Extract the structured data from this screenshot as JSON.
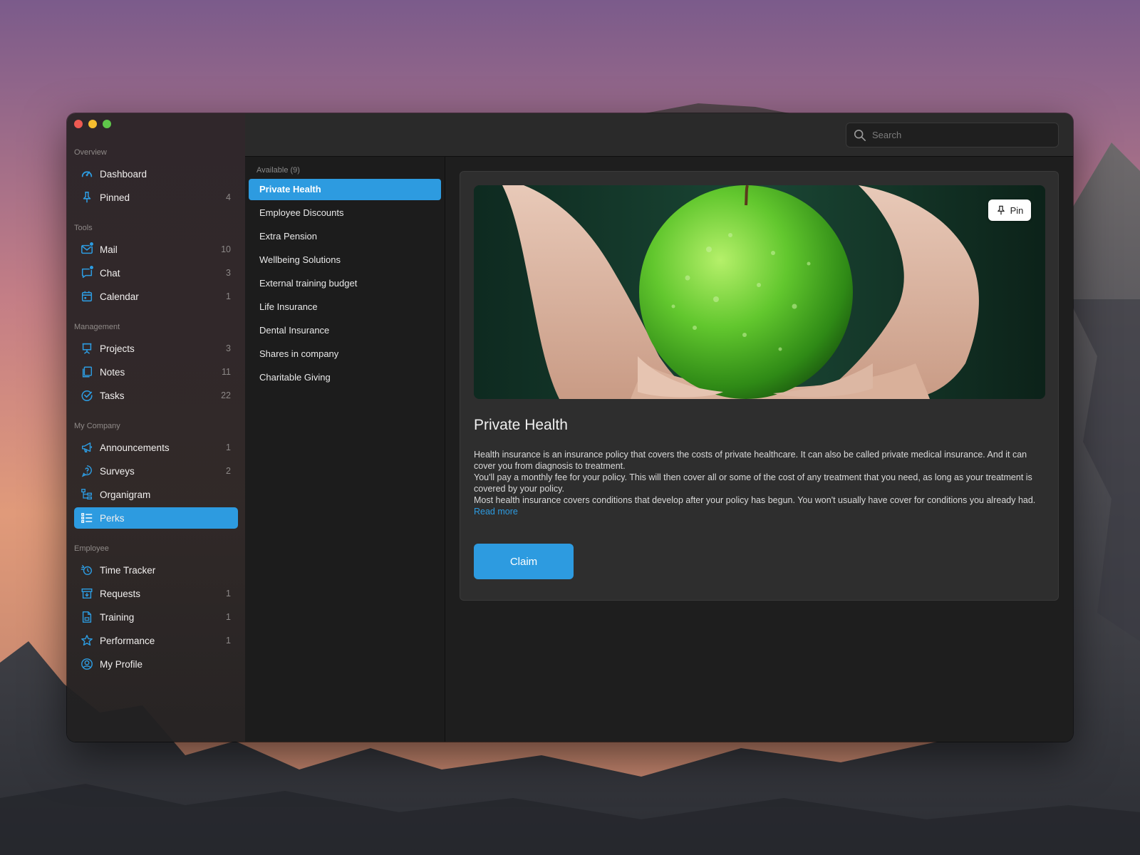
{
  "window": {
    "traffic_lights": [
      "close",
      "minimize",
      "maximize"
    ]
  },
  "sidebar": {
    "sections": [
      {
        "heading": "Overview",
        "items": [
          {
            "label": "Dashboard",
            "icon": "dashboard-icon",
            "count": ""
          },
          {
            "label": "Pinned",
            "icon": "pin-icon",
            "count": "4"
          }
        ]
      },
      {
        "heading": "Tools",
        "items": [
          {
            "label": "Mail",
            "icon": "mail-icon",
            "count": "10"
          },
          {
            "label": "Chat",
            "icon": "chat-icon",
            "count": "3"
          },
          {
            "label": "Calendar",
            "icon": "calendar-icon",
            "count": "1"
          }
        ]
      },
      {
        "heading": "Management",
        "items": [
          {
            "label": "Projects",
            "icon": "projects-icon",
            "count": "3"
          },
          {
            "label": "Notes",
            "icon": "notes-icon",
            "count": "11"
          },
          {
            "label": "Tasks",
            "icon": "tasks-icon",
            "count": "22"
          }
        ]
      },
      {
        "heading": "My Company",
        "items": [
          {
            "label": "Announcements",
            "icon": "megaphone-icon",
            "count": "1"
          },
          {
            "label": "Surveys",
            "icon": "survey-icon",
            "count": "2"
          },
          {
            "label": "Organigram",
            "icon": "organigram-icon",
            "count": ""
          },
          {
            "label": "Perks",
            "icon": "perks-icon",
            "count": ""
          }
        ]
      },
      {
        "heading": "Employee",
        "items": [
          {
            "label": "Time Tracker",
            "icon": "time-tracker-icon",
            "count": ""
          },
          {
            "label": "Requests",
            "icon": "requests-icon",
            "count": "1"
          },
          {
            "label": "Training",
            "icon": "training-icon",
            "count": "1"
          },
          {
            "label": "Performance",
            "icon": "star-icon",
            "count": "1"
          },
          {
            "label": "My Profile",
            "icon": "profile-icon",
            "count": ""
          }
        ]
      }
    ],
    "active_item": "Perks"
  },
  "search": {
    "placeholder": "Search"
  },
  "perks_list": {
    "heading": "Available (9)",
    "items": [
      "Private Health",
      "Employee Discounts",
      "Extra Pension",
      "Wellbeing Solutions",
      "External training budget",
      "Life Insurance",
      "Dental Insurance",
      "Shares in company",
      "Charitable Giving"
    ],
    "active_item": "Private Health"
  },
  "detail": {
    "pin_label": "Pin",
    "title": "Private Health",
    "paragraphs": [
      "Health insurance is an insurance policy that covers the costs of private healthcare. It can also be called private medical insurance. And it can cover you from diagnosis to treatment.",
      "You'll pay a monthly fee for your policy. This will then cover all or some of the cost of any treatment that you need, as long as your treatment is covered by your policy.",
      "Most health insurance covers conditions that develop after your policy has begun. You won't usually have cover for conditions you already had."
    ],
    "read_more": "Read more",
    "claim_label": "Claim"
  },
  "colors": {
    "accent": "#2d9be0",
    "sidebar_bg": "#272223",
    "pane_bg": "#1e1e1e",
    "card_bg": "#2e2e2e"
  }
}
